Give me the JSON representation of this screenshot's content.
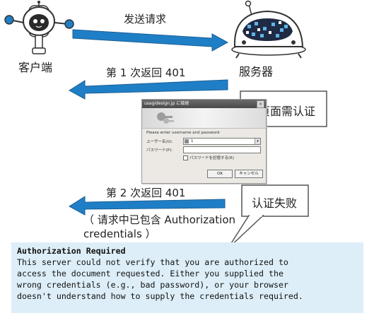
{
  "client_label": "客户端",
  "server_label": "服务器",
  "arrows": {
    "send_request": "发送请求",
    "first_return": "第 1 次返回 401",
    "second_return": "第 2 次返回 401",
    "second_note_line1": "（ 请求中已包含 Authorization",
    "second_note_line2": "credentials ）"
  },
  "callouts": {
    "page_needs_auth": "本页面需认证",
    "auth_failed": "认证失败"
  },
  "dialog": {
    "title": "usagidesign.jp に接続",
    "close_glyph": "×",
    "prompt": "Please enter username and password",
    "username_label": "ユーザー名(U):",
    "username_value": "1",
    "password_label": "パスワード(P):",
    "remember_label": "パスワードを記憶する(R)",
    "ok_label": "OK",
    "cancel_label": "キャンセル",
    "dropdown_glyph": "▾"
  },
  "error": {
    "title": "Authorization Required",
    "lines": [
      "This server could not verify that you are authorized to",
      "access the document requested. Either you supplied the",
      "wrong credentials (e.g., bad password), or your browser",
      "doesn't understand how to supply the credentials required."
    ]
  },
  "colors": {
    "arrow_blue": "#1f7fc6",
    "error_bg": "#ddeef8"
  }
}
